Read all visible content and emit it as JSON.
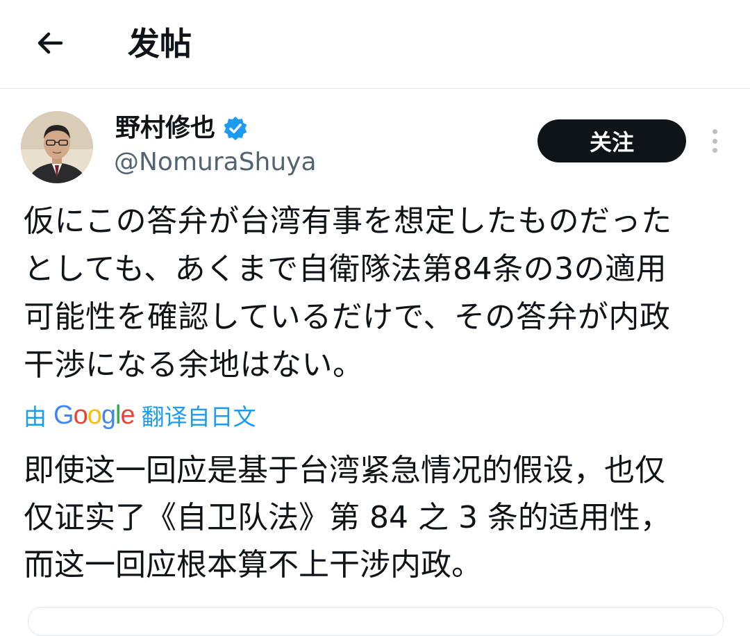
{
  "header": {
    "title": "发帖",
    "back_icon": "arrow-left-icon"
  },
  "author": {
    "name": "野村修也",
    "handle": "@NomuraShuya",
    "verified": true,
    "verified_color": "#1d9bf0"
  },
  "actions": {
    "follow_label": "关注"
  },
  "tweet": {
    "text": "仮にこの答弁が台湾有事を想定したものだった\nとしても、あくまで自衛隊法第84条の3の適用\n可能性を確認しているだけで、その答弁が内政\n干渉になる余地はない。"
  },
  "translation": {
    "prefix": "由",
    "provider": "Google",
    "suffix": "翻译自日文",
    "link_color": "#1d9bf0",
    "text": "即使这一回应是基于台湾紧急情况的假设，也仅\n仅证实了《自卫队法》第 84 之 3 条的适用性，\n而这一回应根本算不上干涉内政。"
  },
  "colors": {
    "follow_bg": "#0f1419",
    "text": "#0f1419",
    "secondary": "#536471"
  }
}
